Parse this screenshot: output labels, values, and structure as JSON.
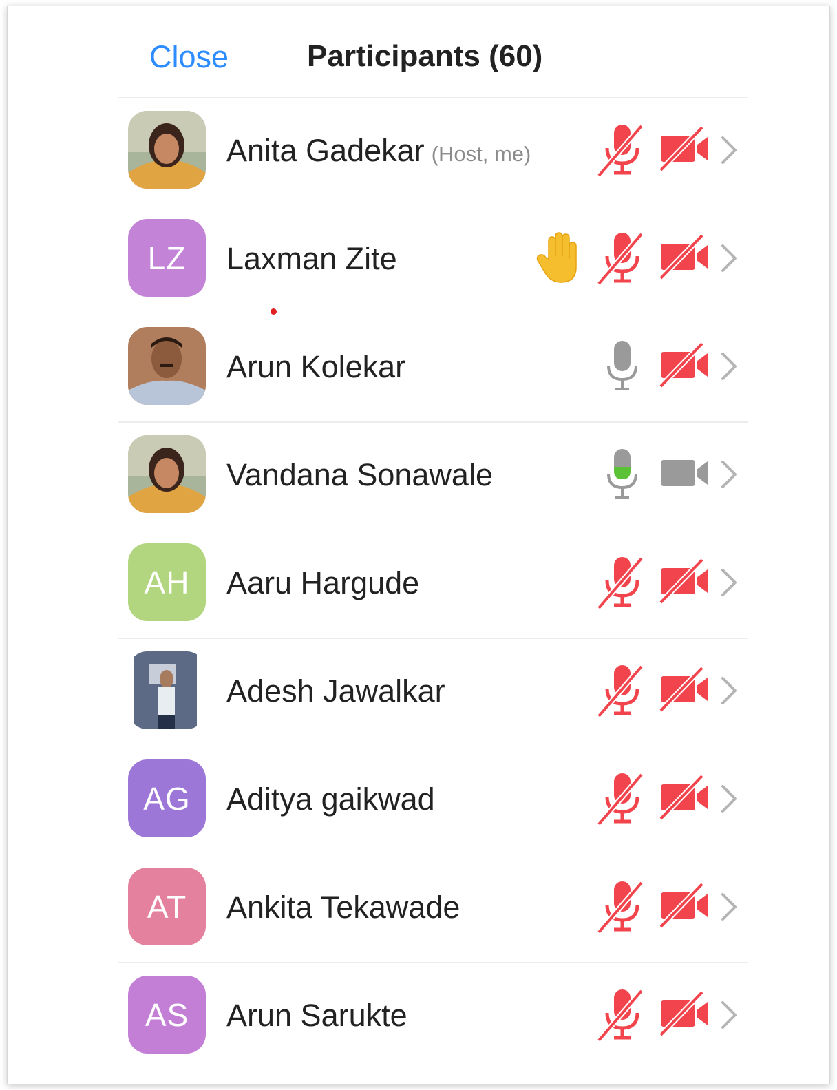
{
  "header": {
    "close_label": "Close",
    "title": "Participants (60)"
  },
  "colors": {
    "accent": "#2d8cff",
    "muted_red": "#f2444d",
    "active_green": "#5bc236",
    "idle_gray": "#9a9a9a"
  },
  "participants": [
    {
      "name": "Anita Gadekar",
      "tag": "(Host, me)",
      "avatar_type": "photo",
      "avatar_icon": "woman-photo",
      "mic": "muted",
      "video": "off",
      "hand_raised": false
    },
    {
      "name": "Laxman Zite",
      "tag": "",
      "avatar_type": "initials",
      "initials": "LZ",
      "avatar_color": "#c383d6",
      "mic": "muted",
      "video": "off",
      "hand_raised": true
    },
    {
      "name": "Arun Kolekar",
      "tag": "",
      "avatar_type": "photo",
      "avatar_icon": "man-photo",
      "mic": "unmuted",
      "video": "off",
      "hand_raised": false
    },
    {
      "name": "Vandana Sonawale",
      "tag": "",
      "avatar_type": "photo",
      "avatar_icon": "woman-photo",
      "mic": "speaking",
      "video": "on",
      "hand_raised": false
    },
    {
      "name": "Aaru Hargude",
      "tag": "",
      "avatar_type": "initials",
      "initials": "AH",
      "avatar_color": "#b1d67f",
      "mic": "muted",
      "video": "off",
      "hand_raised": false
    },
    {
      "name": "Adesh Jawalkar",
      "tag": "",
      "avatar_type": "photo",
      "avatar_icon": "person-photo",
      "mic": "muted",
      "video": "off",
      "hand_raised": false
    },
    {
      "name": "Aditya gaikwad",
      "tag": "",
      "avatar_type": "initials",
      "initials": "AG",
      "avatar_color": "#9d77d8",
      "mic": "muted",
      "video": "off",
      "hand_raised": false
    },
    {
      "name": "Ankita Tekawade",
      "tag": "",
      "avatar_type": "initials",
      "initials": "AT",
      "avatar_color": "#e4819f",
      "mic": "muted",
      "video": "off",
      "hand_raised": false
    },
    {
      "name": "Arun Sarukte",
      "tag": "",
      "avatar_type": "initials",
      "initials": "AS",
      "avatar_color": "#c37fd6",
      "mic": "muted",
      "video": "off",
      "hand_raised": false
    }
  ]
}
